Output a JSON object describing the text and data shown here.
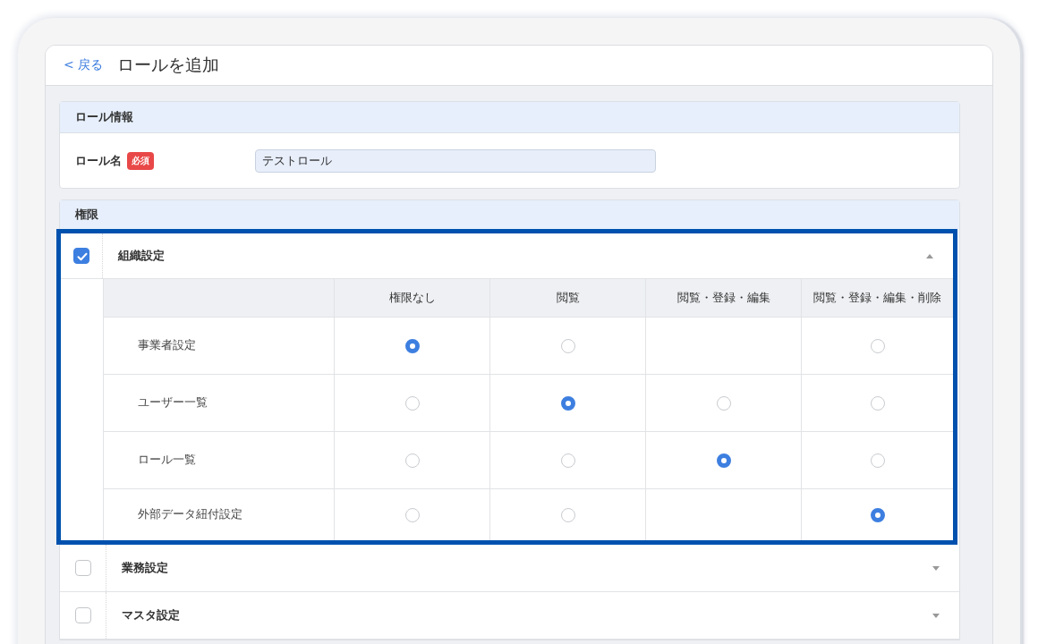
{
  "header": {
    "back_link": "< 戻る",
    "title": "ロールを追加"
  },
  "role_info": {
    "title": "ロール情報",
    "name_label": "ロール名",
    "required_badge": "必須",
    "name_value": "テストロール"
  },
  "permissions": {
    "title": "権限",
    "groups": [
      {
        "label": "組織設定",
        "checked": true,
        "expanded": true,
        "highlighted": true,
        "columns": [
          "権限なし",
          "閲覧",
          "閲覧・登録・編集",
          "閲覧・登録・編集・削除"
        ],
        "rows": [
          {
            "label": "事業者設定",
            "cells": [
              {
                "kind": "radio",
                "selected": true
              },
              {
                "kind": "radio",
                "selected": false
              },
              {
                "kind": "empty"
              },
              {
                "kind": "radio",
                "selected": false
              }
            ]
          },
          {
            "label": "ユーザー一覧",
            "cells": [
              {
                "kind": "radio",
                "selected": false
              },
              {
                "kind": "radio",
                "selected": true
              },
              {
                "kind": "radio",
                "selected": false
              },
              {
                "kind": "radio",
                "selected": false
              }
            ]
          },
          {
            "label": "ロール一覧",
            "cells": [
              {
                "kind": "radio",
                "selected": false
              },
              {
                "kind": "radio",
                "selected": false
              },
              {
                "kind": "radio",
                "selected": true
              },
              {
                "kind": "radio",
                "selected": false
              }
            ]
          },
          {
            "label": "外部データ紐付設定",
            "cells": [
              {
                "kind": "radio",
                "selected": false
              },
              {
                "kind": "radio",
                "selected": false
              },
              {
                "kind": "empty"
              },
              {
                "kind": "radio",
                "selected": true
              }
            ]
          }
        ]
      },
      {
        "label": "業務設定",
        "checked": false,
        "expanded": false,
        "highlighted": false
      },
      {
        "label": "マスタ設定",
        "checked": false,
        "expanded": false,
        "highlighted": false
      }
    ]
  }
}
